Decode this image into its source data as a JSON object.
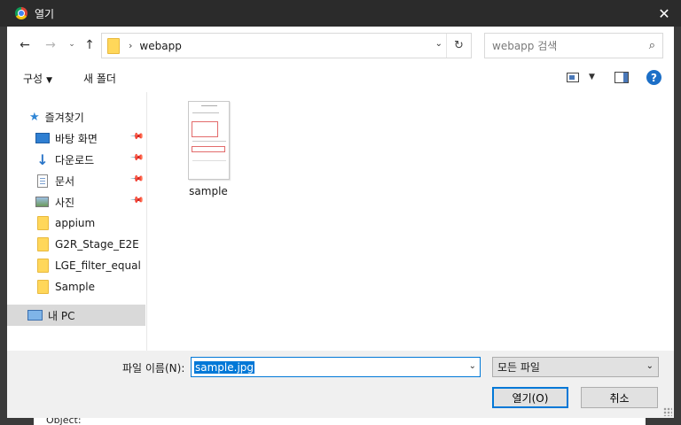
{
  "titlebar": {
    "title": "열기",
    "close_glyph": "✕"
  },
  "nav": {
    "back_glyph": "←",
    "forward_glyph": "→",
    "recent_glyph": "⌄",
    "up_glyph": "↑"
  },
  "address": {
    "separator": "›",
    "path": "webapp",
    "dropdown_glyph": "⌄",
    "refresh_glyph": "↻"
  },
  "search": {
    "placeholder": "webapp 검색",
    "icon_glyph": "⌕"
  },
  "commandbar": {
    "organize_label": "구성",
    "organize_caret": "▼",
    "new_folder_label": "새 폴더",
    "view_caret": "▼",
    "help_label": "?"
  },
  "sidebar": {
    "items": [
      {
        "label": "즐겨찾기",
        "icon": "star-icon"
      },
      {
        "label": "바탕 화면",
        "icon": "desktop-icon",
        "pinned": true
      },
      {
        "label": "다운로드",
        "icon": "download-icon",
        "pinned": true
      },
      {
        "label": "문서",
        "icon": "document-icon",
        "pinned": true
      },
      {
        "label": "사진",
        "icon": "pictures-icon",
        "pinned": true
      },
      {
        "label": "appium",
        "icon": "folder-icon"
      },
      {
        "label": "G2R_Stage_E2E",
        "icon": "folder-icon"
      },
      {
        "label": "LGE_filter_equal",
        "icon": "folder-icon"
      },
      {
        "label": "Sample",
        "icon": "folder-icon"
      },
      {
        "label": "내 PC",
        "icon": "pc-icon",
        "selected": true
      }
    ],
    "star_glyph": "★",
    "download_glyph": "↓",
    "pin_glyph": "📌"
  },
  "files": [
    {
      "name": "sample",
      "type": "image-thumbnail"
    }
  ],
  "bottom": {
    "filename_label": "파일 이름(N):",
    "filename_value": "sample.jpg",
    "dropdown_glyph": "⌄",
    "filetype_value": "모든 파일",
    "open_label": "열기(O)",
    "cancel_label": "취소"
  },
  "background": {
    "partial_text": "Object:"
  },
  "colors": {
    "accent": "#0078d7",
    "titlebar": "#2b2b2b",
    "folder": "#ffd75a"
  }
}
